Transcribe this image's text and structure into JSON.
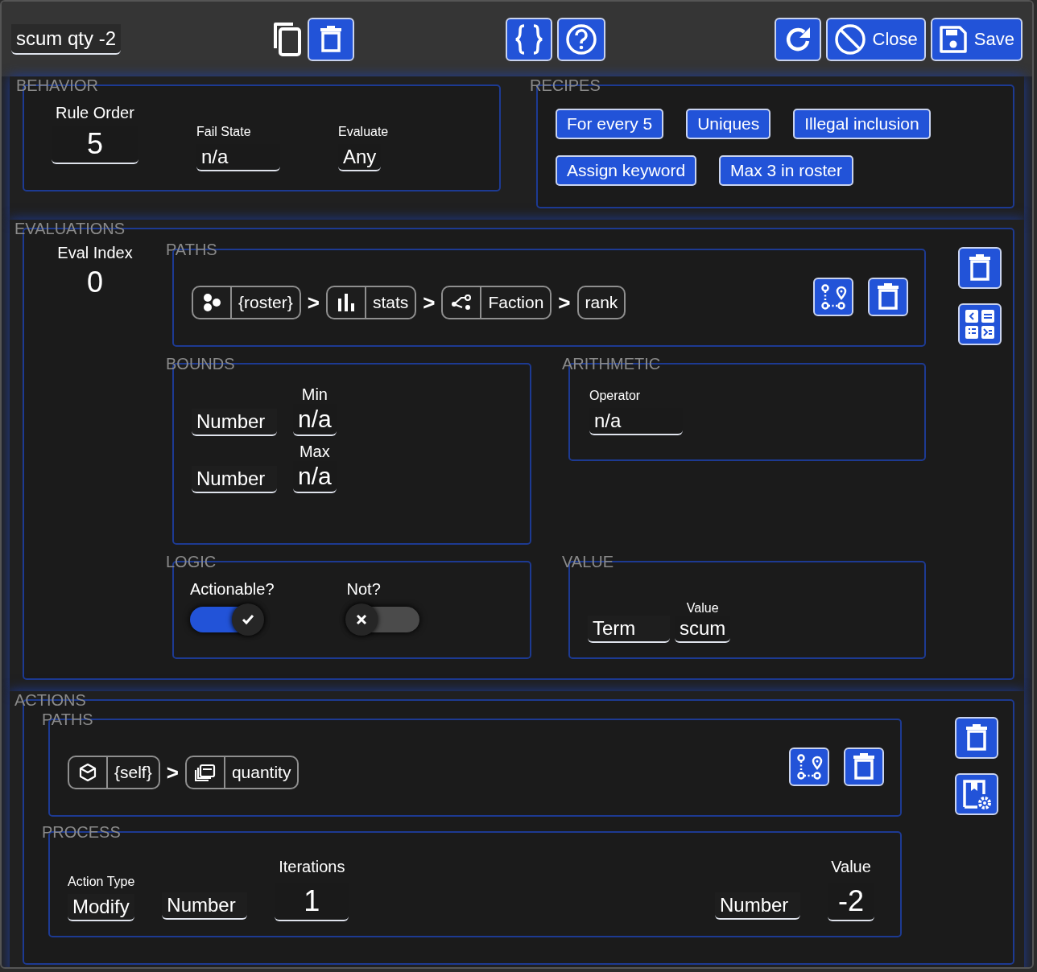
{
  "title_field": {
    "value": "scum qty -2"
  },
  "toolbar": {
    "buttons": [
      {
        "kind": "copy"
      },
      {
        "kind": "delete"
      },
      {
        "kind": "json"
      },
      {
        "kind": "help"
      },
      {
        "kind": "refresh"
      },
      {
        "kind": "close",
        "label": "Close"
      },
      {
        "kind": "save",
        "label": "Save"
      }
    ]
  },
  "behavior": {
    "heading": "BEHAVIOR",
    "rule_order": {
      "label": "Rule Order",
      "value": "5"
    },
    "fail_state": {
      "label": "Fail State",
      "value": "n/a"
    },
    "evaluate": {
      "label": "Evaluate",
      "value": "Any"
    }
  },
  "recipes": {
    "heading": "RECIPES",
    "items": [
      "For every 5",
      "Uniques",
      "Illegal inclusion",
      "Assign keyword",
      "Max 3 in roster"
    ]
  },
  "evaluations": {
    "heading": "EVALUATIONS",
    "eval_index": {
      "label": "Eval Index",
      "value": "0"
    },
    "paths": {
      "heading": "PATHS",
      "segments": [
        {
          "kind": "roster",
          "label": "{roster}"
        },
        {
          "kind": "stats",
          "label": "stats",
          "separator": ">"
        },
        {
          "kind": "branch",
          "label": "Faction",
          "separator": ">"
        },
        {
          "kind": "plain",
          "label": "rank",
          "separator": ">"
        }
      ]
    },
    "bounds": {
      "heading": "BOUNDS",
      "rows": [
        {
          "label": "Min",
          "type": "Number",
          "value": "n/a"
        },
        {
          "label": "Max",
          "type": "Number",
          "value": "n/a"
        }
      ]
    },
    "arithmetic": {
      "heading": "ARITHMETIC",
      "operator": {
        "label": "Operator",
        "value": "n/a"
      }
    },
    "logic": {
      "heading": "LOGIC",
      "toggles": [
        {
          "label": "Actionable?",
          "on": true
        },
        {
          "label": "Not?",
          "on": false
        }
      ]
    },
    "value": {
      "heading": "VALUE",
      "type": "Term",
      "label": "Value",
      "value": "scum"
    }
  },
  "actions": {
    "heading": "ACTIONS",
    "paths": {
      "heading": "PATHS",
      "segments": [
        {
          "kind": "self",
          "label": "{self}"
        },
        {
          "kind": "layers",
          "label": "quantity",
          "separator": ">"
        }
      ]
    },
    "process": {
      "heading": "PROCESS",
      "action_type": {
        "label": "Action Type",
        "value": "Modify"
      },
      "iterations": {
        "type": "Number",
        "label": "Iterations",
        "value": "1"
      },
      "value": {
        "type": "Number",
        "label": "Value",
        "value": "-2"
      }
    }
  }
}
